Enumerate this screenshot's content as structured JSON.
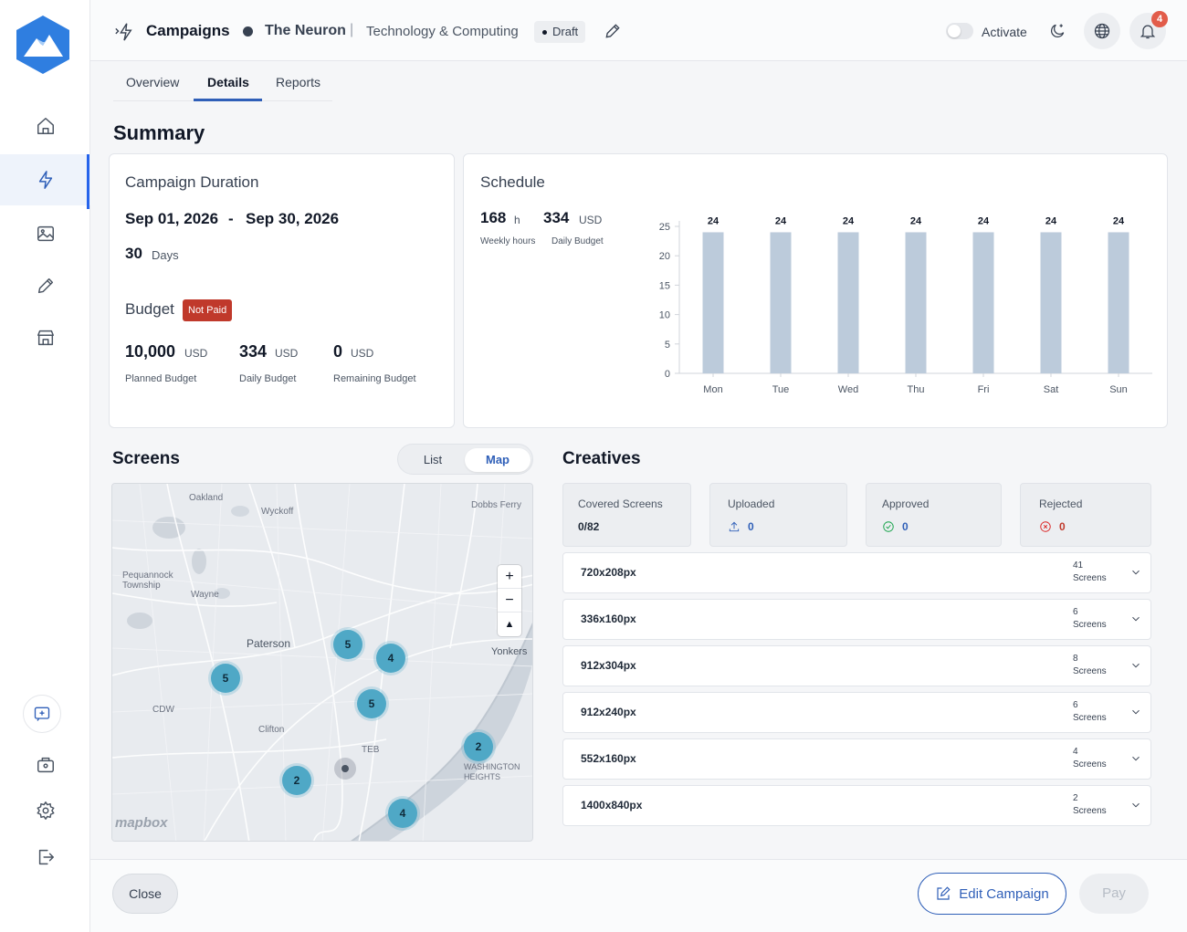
{
  "header": {
    "title": "Campaigns",
    "campaign_name": "The Neuron",
    "separator": "|",
    "category": "Technology & Computing",
    "status": "Draft",
    "activate_label": "Activate",
    "notification_count": "4"
  },
  "tabs": [
    {
      "label": "Overview"
    },
    {
      "label": "Details",
      "active": true
    },
    {
      "label": "Reports"
    }
  ],
  "summary": {
    "title": "Summary",
    "duration": {
      "label": "Campaign Duration",
      "start": "Sep 01, 2026",
      "dash": "-",
      "end": "Sep 30, 2026",
      "days_value": "30",
      "days_label": "Days"
    },
    "budget": {
      "label": "Budget",
      "badge": "Not Paid",
      "planned_value": "10,000",
      "planned_unit": "USD",
      "planned_label": "Planned Budget",
      "daily_value": "334",
      "daily_unit": "USD",
      "daily_label": "Daily Budget",
      "remaining_value": "0",
      "remaining_unit": "USD",
      "remaining_label": "Remaining Budget"
    },
    "schedule": {
      "label": "Schedule",
      "weekly_value": "168",
      "weekly_unit": "h",
      "weekly_label": "Weekly hours",
      "daily_value": "334",
      "daily_unit": "USD",
      "daily_label": "Daily Budget"
    }
  },
  "chart_data": {
    "type": "bar",
    "categories": [
      "Mon",
      "Tue",
      "Wed",
      "Thu",
      "Fri",
      "Sat",
      "Sun"
    ],
    "values": [
      24,
      24,
      24,
      24,
      24,
      24,
      24
    ],
    "ylim": [
      0,
      25
    ],
    "yticks": [
      0,
      5,
      10,
      15,
      20,
      25
    ],
    "data_labels": true,
    "bar_color": "#bccbdb",
    "grid": false
  },
  "screens": {
    "title": "Screens",
    "view_options": [
      "List",
      "Map"
    ],
    "active_view": "Map",
    "map_labels": [
      "Oakland",
      "Wyckoff",
      "Dobbs Ferry",
      "Pequannock Township",
      "Wayne",
      "Paterson",
      "Yonkers",
      "CDW",
      "Clifton",
      "TEB",
      "WASHINGTON HEIGHTS"
    ],
    "clusters": [
      "5",
      "4",
      "5",
      "5",
      "2",
      "2",
      "4"
    ],
    "zoom_in": "+",
    "zoom_out": "−",
    "compass": "▲",
    "attribution": "mapbox"
  },
  "creatives": {
    "title": "Creatives",
    "stats": [
      {
        "label": "Covered Screens",
        "value": "0/82",
        "icon": "none"
      },
      {
        "label": "Uploaded",
        "value": "0",
        "icon": "upload-icon"
      },
      {
        "label": "Approved",
        "value": "0",
        "icon": "check-circle-icon"
      },
      {
        "label": "Rejected",
        "value": "0",
        "icon": "x-circle-icon"
      }
    ],
    "sizes": [
      {
        "label": "720x208px",
        "count": "41",
        "unit": "Screens"
      },
      {
        "label": "336x160px",
        "count": "6",
        "unit": "Screens"
      },
      {
        "label": "912x304px",
        "count": "8",
        "unit": "Screens"
      },
      {
        "label": "912x240px",
        "count": "6",
        "unit": "Screens"
      },
      {
        "label": "552x160px",
        "count": "4",
        "unit": "Screens"
      },
      {
        "label": "1400x840px",
        "count": "2",
        "unit": "Screens"
      }
    ]
  },
  "footer": {
    "close_label": "Close",
    "edit_label": "Edit Campaign",
    "pay_label": "Pay"
  },
  "colors": {
    "accent": "#2f5fb8",
    "badge_red": "#c0392b",
    "cluster": "#4fa8c6",
    "notification": "#e25c4a"
  }
}
